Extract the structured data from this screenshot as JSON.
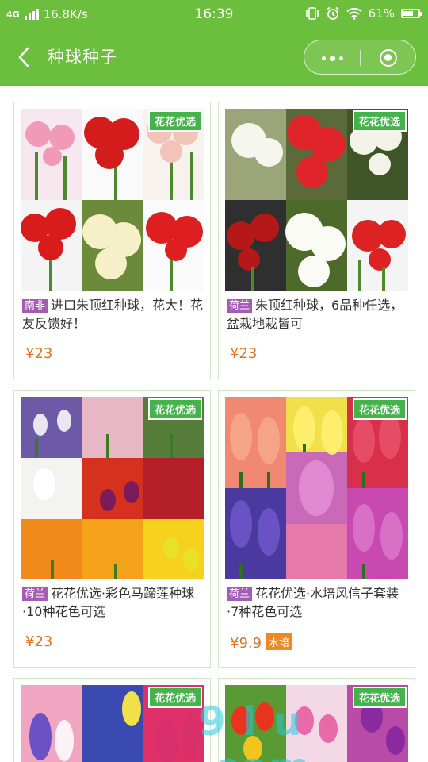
{
  "status": {
    "network": "4G",
    "speed": "16.8K/s",
    "time": "16:39",
    "battery": "61%"
  },
  "nav": {
    "title": "种球种子"
  },
  "pick_badge": "花花优选",
  "products": [
    {
      "origin": "南非",
      "title": "进口朱顶红种球，花大！花友反馈好！",
      "price": "¥23"
    },
    {
      "origin": "荷兰",
      "title": "朱顶红种球，6品种任选，盆栽地栽皆可",
      "price": "¥23"
    },
    {
      "origin": "荷兰",
      "title": "花花优选·彩色马蹄莲种球·10种花色可选",
      "price": "¥23"
    },
    {
      "origin": "荷兰",
      "title": "花花优选·水培风信子套装·7种花色可选",
      "price": "¥9.9",
      "tag": "水培"
    }
  ],
  "colors": {
    "header": "#6cbf3c",
    "price": "#e2731b",
    "origin_badge": "#a65bb4",
    "pick_badge": "#43b449",
    "card_border": "#cfe9c1"
  },
  "watermark": "9 l u .com"
}
